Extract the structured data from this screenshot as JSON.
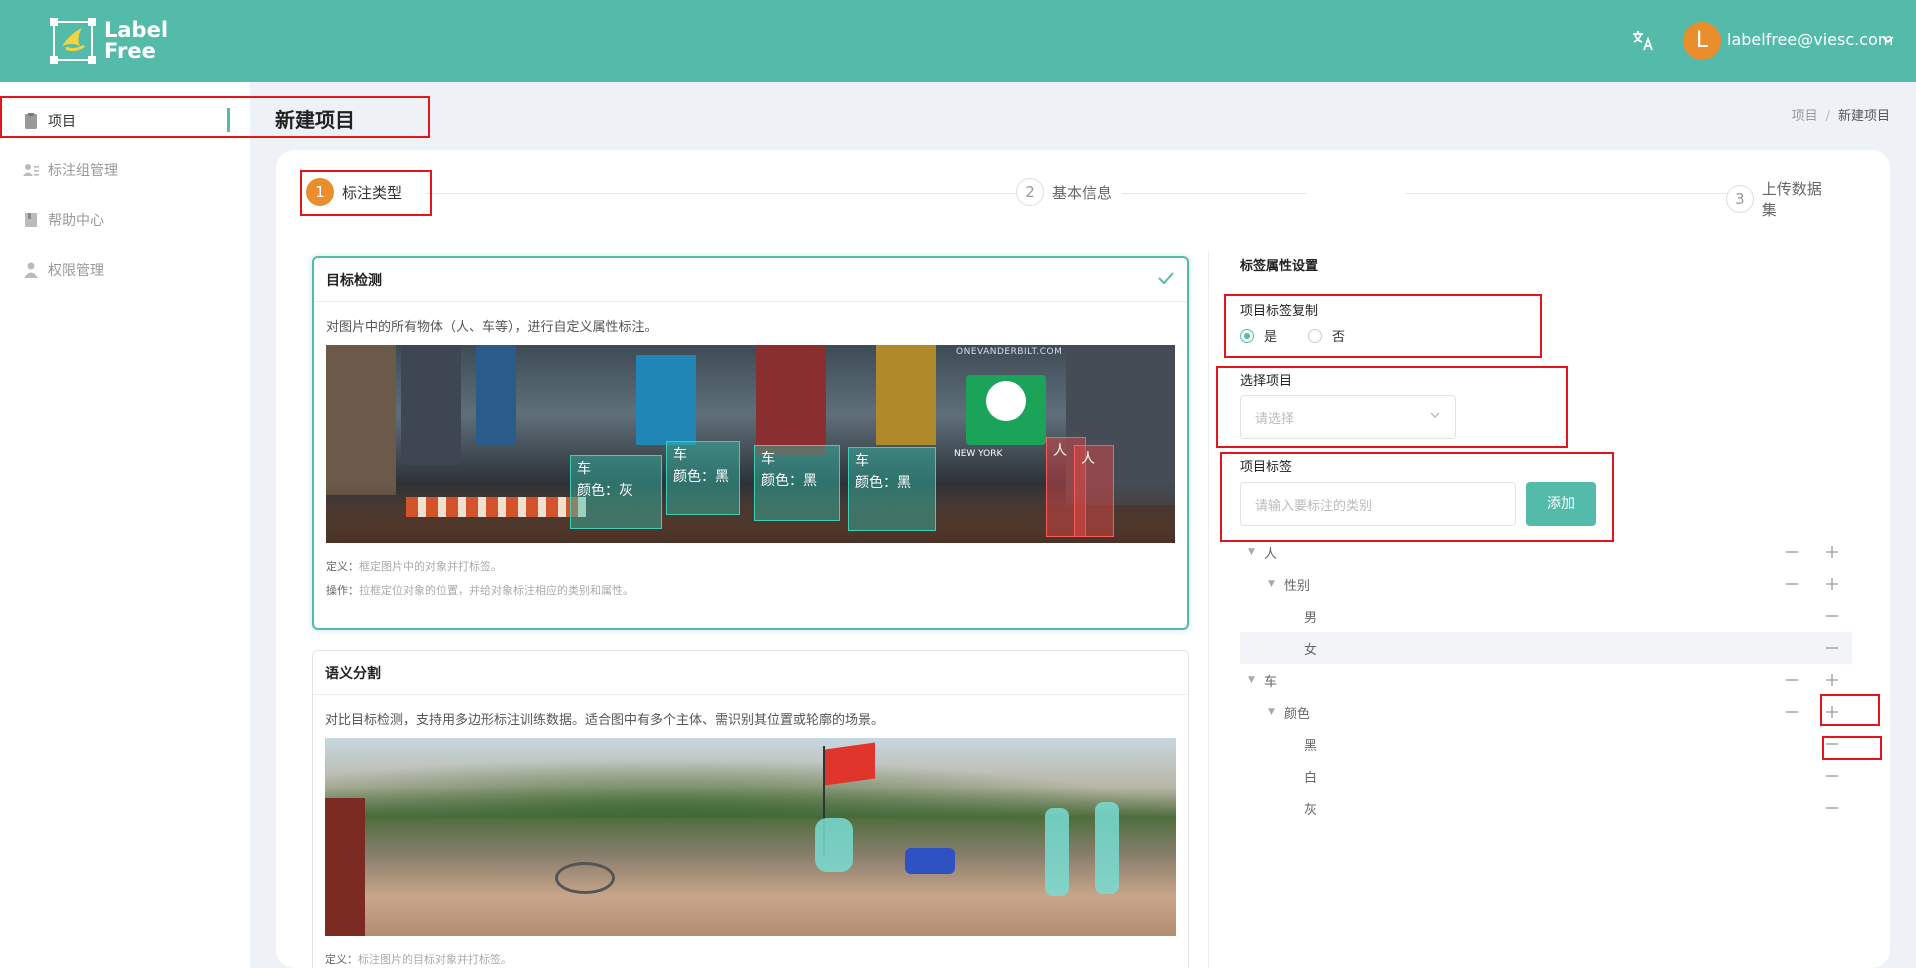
{
  "header": {
    "logo_line1": "Label",
    "logo_line2": "Free",
    "user_initial": "L",
    "user_email": "labelfree@viesc.com"
  },
  "sidebar": {
    "items": [
      {
        "label": "项目",
        "icon": "clipboard-icon",
        "active": true
      },
      {
        "label": "标注组管理",
        "icon": "group-icon",
        "active": false
      },
      {
        "label": "帮助中心",
        "icon": "book-icon",
        "active": false
      },
      {
        "label": "权限管理",
        "icon": "user-icon",
        "active": false
      }
    ]
  },
  "page": {
    "title": "新建项目",
    "breadcrumb": [
      "项目",
      "新建项目"
    ]
  },
  "steps": [
    {
      "num": "1",
      "label": "标注类型",
      "active": true
    },
    {
      "num": "2",
      "label": "基本信息",
      "active": false
    },
    {
      "num": "3",
      "label": "上传数据集",
      "active": false
    }
  ],
  "types": [
    {
      "title": "目标检测",
      "desc": "对图片中的所有物体（人、车等），进行自定义属性标注。",
      "def_label": "定义：",
      "def_text": "框定图片中的对象并打标签。",
      "op_label": "操作：",
      "op_text": "拉框定位对象的位置，并给对象标注相应的类别和属性。",
      "selected": true,
      "annotations": [
        {
          "title": "车",
          "attr": "颜色：灰"
        },
        {
          "title": "车",
          "attr": "颜色：黑"
        },
        {
          "title": "车",
          "attr": "颜色：黑"
        },
        {
          "title": "车",
          "attr": "颜色：黑"
        },
        {
          "title": "人"
        },
        {
          "title": "人"
        }
      ],
      "sign_text": "ONEVANDERBILT.COM",
      "sign_text2": "NEW YORK"
    },
    {
      "title": "语义分割",
      "desc": "对比目标检测，支持用多边形标注训练数据。适合图中有多个主体、需识别其位置或轮廓的场景。",
      "def_label": "定义：",
      "def_text": "标注图片的目标对象并打标签。",
      "selected": false
    }
  ],
  "right": {
    "title": "标签属性设置",
    "copy_label": "项目标签复制",
    "yes": "是",
    "no": "否",
    "select_label": "选择项目",
    "select_placeholder": "请选择",
    "tag_label": "项目标签",
    "tag_placeholder": "请输入要标注的类别",
    "add_button": "添加",
    "tree": [
      {
        "label": "人",
        "level": 0,
        "caret": true,
        "minus": true,
        "plus": true
      },
      {
        "label": "性别",
        "level": 1,
        "caret": true,
        "minus": true,
        "plus": true
      },
      {
        "label": "男",
        "level": 2,
        "caret": false,
        "minus": true,
        "plus": false
      },
      {
        "label": "女",
        "level": 2,
        "caret": false,
        "minus": true,
        "plus": false,
        "highlight": true
      },
      {
        "label": "车",
        "level": 0,
        "caret": true,
        "minus": true,
        "plus": true
      },
      {
        "label": "颜色",
        "level": 1,
        "caret": true,
        "minus": true,
        "plus": true
      },
      {
        "label": "黑",
        "level": 2,
        "caret": false,
        "minus": true,
        "plus": false
      },
      {
        "label": "白",
        "level": 2,
        "caret": false,
        "minus": true,
        "plus": false
      },
      {
        "label": "灰",
        "level": 2,
        "caret": false,
        "minus": true,
        "plus": false
      }
    ]
  },
  "colors": {
    "primary": "#54bbab",
    "accent": "#e98d2d",
    "highlight_box": "#e4161c"
  }
}
